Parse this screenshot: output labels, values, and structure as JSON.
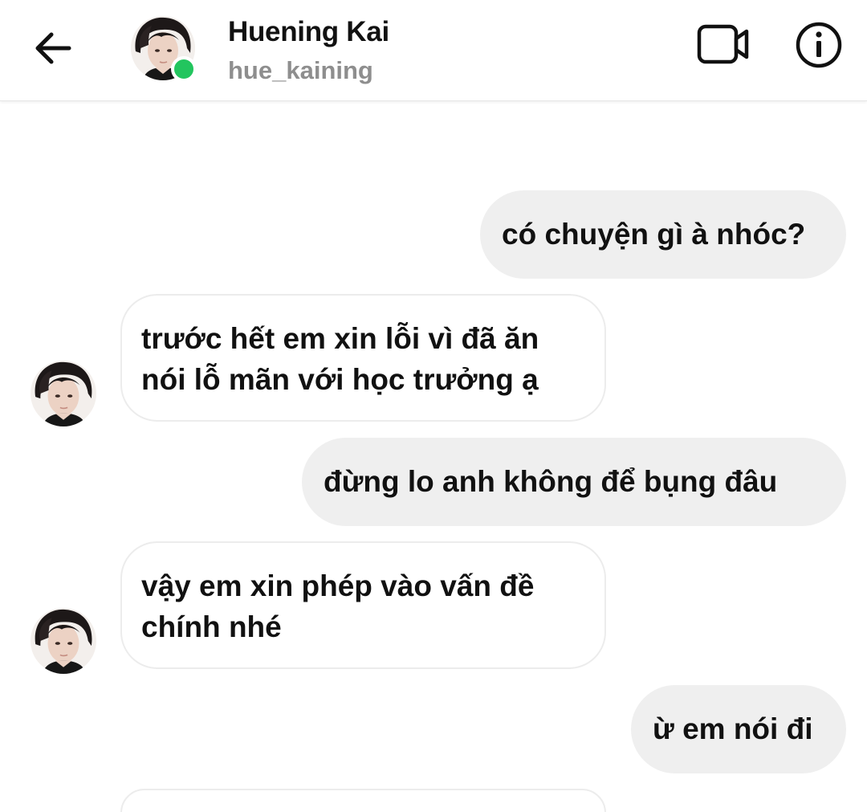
{
  "header": {
    "back_icon": "arrow-left-icon",
    "contact_name": "Huening Kai",
    "contact_username": "hue_kaining",
    "online_status_color": "#22c55e",
    "video_call_icon": "video-camera-icon",
    "info_icon": "info-icon"
  },
  "messages": [
    {
      "from": "me",
      "text": "có chuyện gì à nhóc?"
    },
    {
      "from": "them",
      "lines": [
        "trước hết em xin lỗi vì đã ăn",
        "nói lỗ mãn với học trưởng ạ"
      ]
    },
    {
      "from": "me",
      "text": "đừng lo anh không để bụng đâu"
    },
    {
      "from": "them",
      "lines": [
        "vậy em xin phép vào vấn đề",
        "chính nhé"
      ]
    },
    {
      "from": "me",
      "text": "ừ em nói đi"
    }
  ],
  "colors": {
    "outgoing_bubble": "#efefef",
    "incoming_bubble_border": "#ececec",
    "username": "#8e8e8e"
  }
}
